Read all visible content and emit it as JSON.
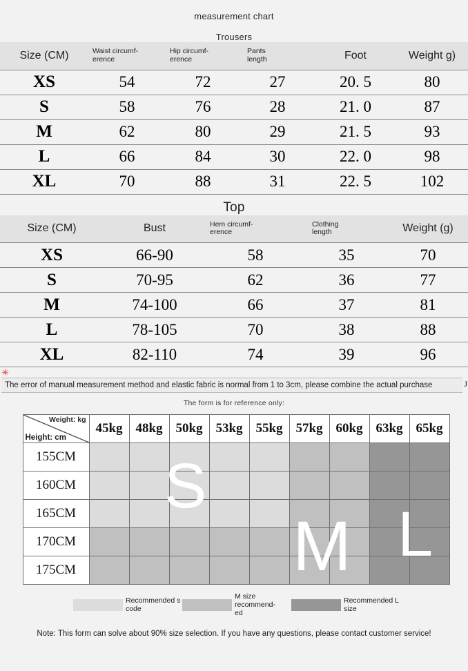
{
  "page": {
    "title": "measurement chart",
    "reference_note": "The form is for reference only:",
    "footer_note": "Note: This form can solve about 90% size selection. If you have any questions, please contact customer service!"
  },
  "trousers": {
    "section_title": "Trousers",
    "headers": [
      "Size (CM)",
      "Waist circumf-\nerence",
      "Hip circumf-\nerence",
      "Pants\nlength",
      "Foot",
      "Weight g)"
    ],
    "header_waist_line1": "Waist circumf-",
    "header_waist_line2": "erence",
    "header_hip_line1": "Hip circumf-",
    "header_hip_line2": "erence",
    "header_pants_line1": "Pants",
    "header_pants_line2": "length",
    "rows": [
      {
        "size": "XS",
        "waist": "54",
        "hip": "72",
        "length": "27",
        "foot": "20. 5",
        "weight": "80"
      },
      {
        "size": "S",
        "waist": "58",
        "hip": "76",
        "length": "28",
        "foot": "21. 0",
        "weight": "87"
      },
      {
        "size": "M",
        "waist": "62",
        "hip": "80",
        "length": "29",
        "foot": "21. 5",
        "weight": "93"
      },
      {
        "size": "L",
        "waist": "66",
        "hip": "84",
        "length": "30",
        "foot": "22. 0",
        "weight": "98"
      },
      {
        "size": "XL",
        "waist": "70",
        "hip": "88",
        "length": "31",
        "foot": "22. 5",
        "weight": "102"
      }
    ]
  },
  "top": {
    "section_title": "Top",
    "headers": [
      "Size (CM)",
      "Bust",
      "Hem circumf-\nerence",
      "Clothing\nlength",
      "Weight (g)"
    ],
    "header_hem_line1": "Hem circumf-",
    "header_hem_line2": "erence",
    "header_clothing_line1": "Clothing",
    "header_clothing_line2": "length",
    "rows": [
      {
        "size": "XS",
        "bust": "66-90",
        "hem": "58",
        "length": "35",
        "weight": "70"
      },
      {
        "size": "S",
        "bust": "70-95",
        "hem": "62",
        "length": "36",
        "weight": "77"
      },
      {
        "size": "M",
        "bust": "74-100",
        "hem": "66",
        "length": "37",
        "weight": "81"
      },
      {
        "size": "L",
        "bust": "78-105",
        "hem": "70",
        "length": "38",
        "weight": "88"
      },
      {
        "size": "XL",
        "bust": "82-110",
        "hem": "74",
        "length": "39",
        "weight": "96"
      }
    ]
  },
  "error_note": {
    "text": "The error of manual measurement method and elastic fabric is normal from 1 to 3cm, please combine the actual purchase",
    "clipped_char": "J",
    "marker": "✳"
  },
  "matrix": {
    "corner_weight_label": "Weight: kg",
    "corner_height_label": "Height: cm",
    "weights": [
      "45kg",
      "48kg",
      "50kg",
      "53kg",
      "55kg",
      "57kg",
      "60kg",
      "63kg",
      "65kg"
    ],
    "heights": [
      "155CM",
      "160CM",
      "165CM",
      "170CM",
      "175CM"
    ],
    "zones": [
      [
        "s",
        "s",
        "s",
        "s",
        "s",
        "m",
        "m",
        "l",
        "l"
      ],
      [
        "s",
        "s",
        "s",
        "s",
        "s",
        "m",
        "m",
        "l",
        "l"
      ],
      [
        "s",
        "s",
        "s",
        "s",
        "s",
        "m",
        "m",
        "l",
        "l"
      ],
      [
        "m",
        "m",
        "m",
        "m",
        "m",
        "m",
        "m",
        "l",
        "l"
      ],
      [
        "m",
        "m",
        "m",
        "m",
        "m",
        "m",
        "m",
        "l",
        "l"
      ]
    ],
    "zone_letters": {
      "s": "S",
      "m": "M",
      "l": "L"
    },
    "colors": {
      "s": "#dcdcdc",
      "m": "#c0c0c0",
      "l": "#969696"
    }
  },
  "legend": [
    {
      "swatch": "s",
      "label_line1": "Recommended s",
      "label_line2": "code",
      "color": "#dcdcdc"
    },
    {
      "swatch": "m",
      "label_line1": "M size recommend-",
      "label_line2": "ed",
      "color": "#c0c0c0"
    },
    {
      "swatch": "l",
      "label_line1": "Recommended L",
      "label_line2": "size",
      "color": "#969696"
    }
  ]
}
